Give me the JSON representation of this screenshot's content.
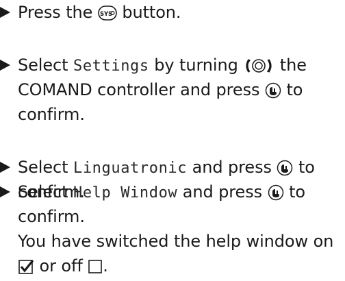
{
  "steps": [
    {
      "lines": [
        {
          "pre": "Press the ",
          "sys_button": "SYS",
          "post": " button."
        }
      ]
    },
    {
      "lines": [
        {
          "pre": "Select ",
          "mono": "Settings",
          "mid": " by turning ",
          "post": " the"
        },
        {
          "pre": "COMAND controller and press ",
          "post": " to"
        },
        {
          "pre": "confirm."
        }
      ]
    },
    {
      "lines": [
        {
          "pre": "Select ",
          "mono": "Linguatronic",
          "mid": " and press ",
          "post": " to"
        },
        {
          "pre": "confirm."
        }
      ]
    },
    {
      "lines": [
        {
          "pre": "Select ",
          "mono": "Help Window",
          "mid": " and press ",
          "post": " to"
        },
        {
          "pre": "confirm."
        },
        {
          "pre": "You have switched the help window on"
        },
        {
          "mid": " or off ",
          "post": "."
        }
      ]
    }
  ],
  "icons": {
    "sys_button": "sys-button-icon",
    "controller_turn": "controller-turn-icon",
    "controller_press": "controller-press-icon",
    "checkbox_checked": "checkbox-checked-icon",
    "checkbox_empty": "checkbox-empty-icon"
  }
}
